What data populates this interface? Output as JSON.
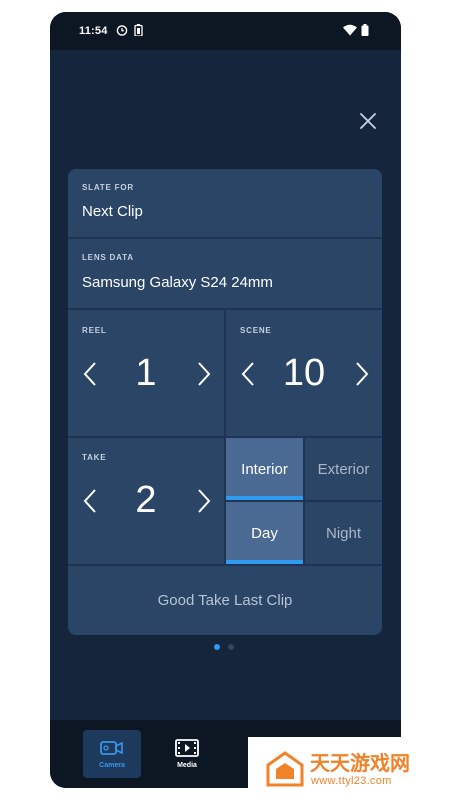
{
  "status_bar": {
    "time": "11:54",
    "icons": [
      "alarm-icon",
      "battery-saver-icon",
      "wifi-icon",
      "battery-icon"
    ]
  },
  "slate": {
    "close_icon": "close-icon",
    "slate_for": {
      "label": "SLATE FOR",
      "value": "Next Clip"
    },
    "lens_data": {
      "label": "LENS DATA",
      "value": "Samsung Galaxy S24 24mm"
    },
    "reel": {
      "label": "REEL",
      "value": "1"
    },
    "scene": {
      "label": "SCENE",
      "value": "10"
    },
    "take": {
      "label": "TAKE",
      "value": "2"
    },
    "location_toggle": {
      "options": [
        "Interior",
        "Exterior"
      ],
      "selected": "Interior"
    },
    "time_toggle": {
      "options": [
        "Day",
        "Night"
      ],
      "selected": "Day"
    },
    "good_take_button": "Good Take Last Clip"
  },
  "page_indicator": {
    "pages": 2,
    "current": 1
  },
  "bottom_nav": {
    "items": [
      {
        "label": "Camera",
        "icon": "camera-icon",
        "active": true
      },
      {
        "label": "Media",
        "icon": "film-icon",
        "active": false
      }
    ]
  },
  "watermark": {
    "title": "天天游戏网",
    "url": "www.ttyl23.com"
  },
  "colors": {
    "background": "#15253b",
    "cell": "#2b4566",
    "active_toggle": "#4a6a93",
    "accent": "#2f9bf0",
    "watermark": "#f0822a"
  }
}
